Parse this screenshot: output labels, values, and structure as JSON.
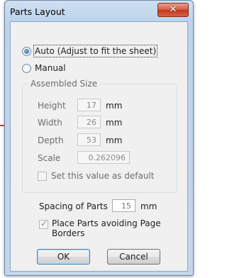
{
  "dialog": {
    "title": "Parts Layout",
    "close_glyph": "✕"
  },
  "layout_mode": {
    "auto_label": "Auto (Adjust to fit the sheet)",
    "manual_label": "Manual",
    "selected": "auto"
  },
  "assembled_size": {
    "group_title": "Assembled Size",
    "height_label": "Height",
    "height_value": "17",
    "height_unit": "mm",
    "width_label": "Width",
    "width_value": "26",
    "width_unit": "mm",
    "depth_label": "Depth",
    "depth_value": "53",
    "depth_unit": "mm",
    "scale_label": "Scale",
    "scale_value": "0.262096",
    "default_label": "Set this value as default"
  },
  "spacing": {
    "label": "Spacing of Parts",
    "value": "15",
    "unit": "mm"
  },
  "avoid_borders": {
    "label_line1": "Place Parts avoiding Page",
    "label_line2": "Borders",
    "checked": true
  },
  "buttons": {
    "ok": "OK",
    "cancel": "Cancel"
  }
}
